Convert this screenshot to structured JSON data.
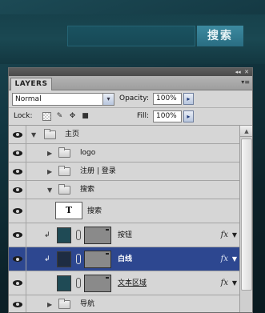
{
  "web": {
    "search_button_label": "搜索"
  },
  "panel": {
    "tab_label": "LAYERS",
    "collapse_glyph": "◂◂",
    "close_glyph": "✕",
    "menu_glyph": "▾≡",
    "blend_mode": "Normal",
    "opacity_label": "Opacity:",
    "opacity_value": "100%",
    "lock_label": "Lock:",
    "fill_label": "Fill:",
    "fill_value": "100%",
    "step_glyph": "▸",
    "dropdown_glyph": "▾"
  },
  "layers": [
    {
      "name": "主页",
      "kind": "group",
      "expanded": true,
      "indent": 0
    },
    {
      "name": "logo",
      "kind": "group",
      "expanded": false,
      "indent": 1
    },
    {
      "name": "注册 | 登录",
      "kind": "group",
      "expanded": false,
      "indent": 1
    },
    {
      "name": "搜索",
      "kind": "group",
      "expanded": true,
      "indent": 1
    },
    {
      "name": "搜索",
      "kind": "text",
      "thumb_glyph": "T",
      "indent": 2
    },
    {
      "name": "按钮",
      "kind": "shape",
      "clipped": true,
      "fx": "fx",
      "indent": 2,
      "selected": false
    },
    {
      "name": "白线",
      "kind": "shape",
      "clipped": true,
      "fx": "fx",
      "indent": 2,
      "selected": true
    },
    {
      "name": "文本区域",
      "kind": "shape",
      "clipped": false,
      "fx": "fx",
      "indent": 2,
      "selected": false,
      "underline": true
    },
    {
      "name": "导航",
      "kind": "group",
      "expanded": false,
      "indent": 1
    }
  ],
  "colors": {
    "selection": "#2d4790",
    "accent_thumb": "#1f4a55"
  }
}
